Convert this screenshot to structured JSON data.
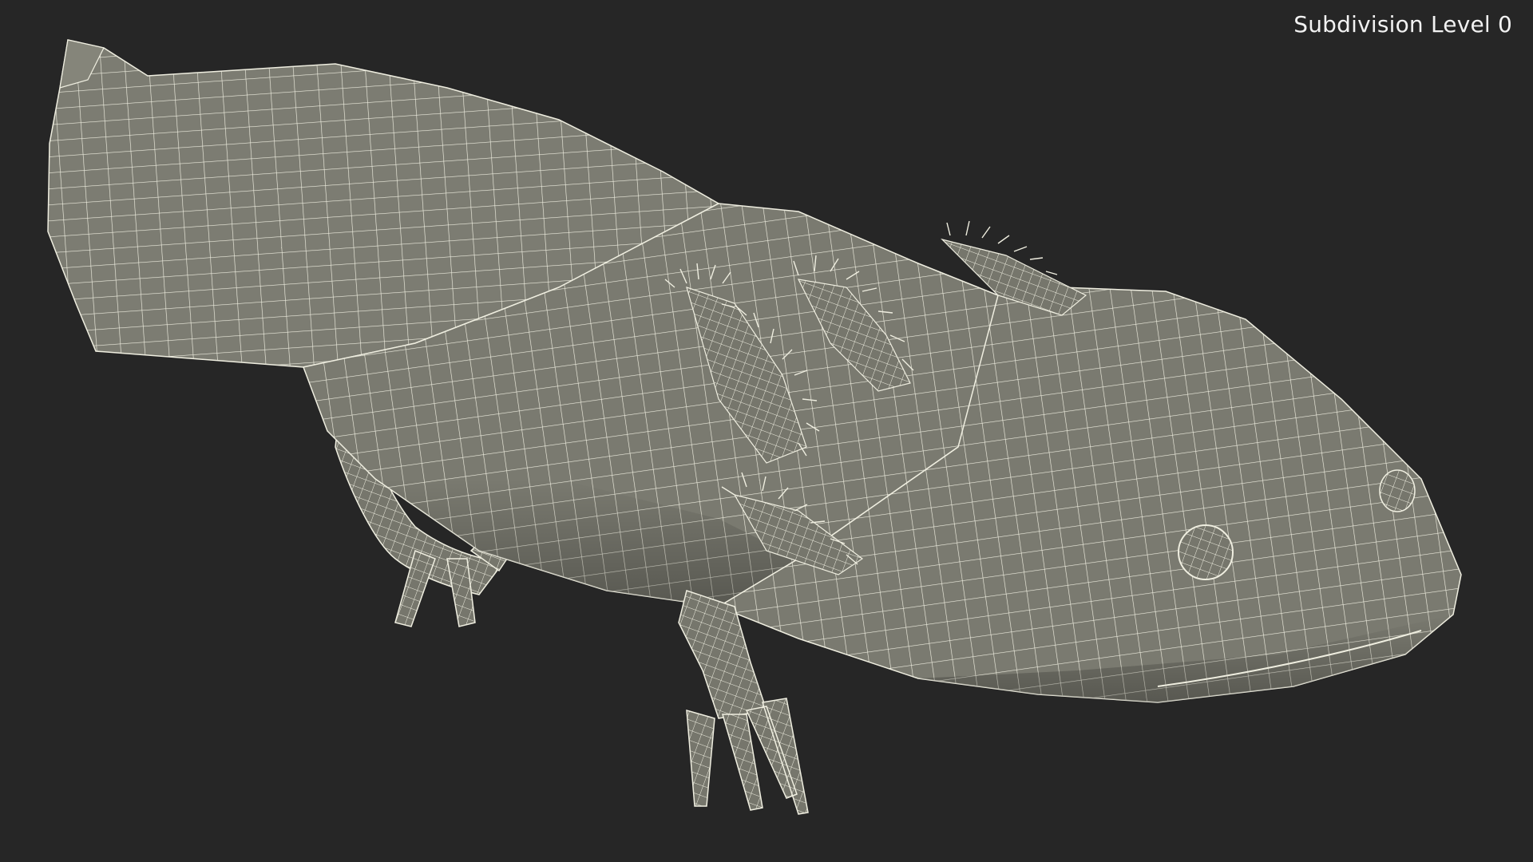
{
  "viewport": {
    "subdivision_label": "Subdivision Level 0",
    "background_color": "#262626",
    "mesh_fill_color": "#7a7a70",
    "wire_color": "#efeee0"
  },
  "model": {
    "subject": "axolotl",
    "display_mode": "wireframe-on-shaded"
  }
}
